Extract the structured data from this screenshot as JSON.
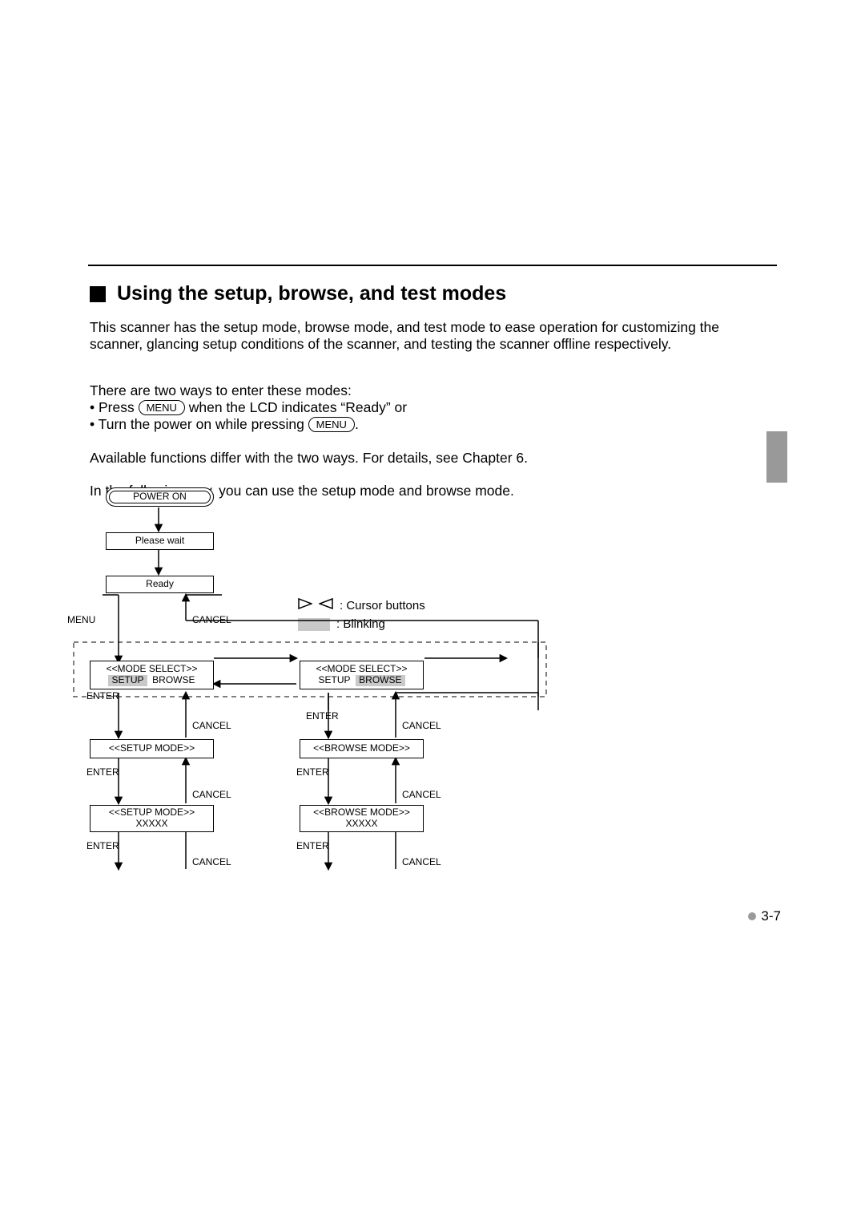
{
  "heading": "Using the setup, browse, and test modes",
  "para1": "This scanner has the setup mode, browse mode, and test mode to ease operation for customizing the scanner, glancing setup conditions of the scanner, and testing the scanner offline respectively.",
  "para2": "There are two ways to enter these modes:",
  "bullet1_pre": "• Press ",
  "bullet1_post": " when the LCD indicates “Ready” or",
  "bullet2_pre": "• Turn the power on while pressing ",
  "bullet2_post": ".",
  "menu_label": "MENU",
  "para3": "Available functions differ with the two ways.  For details, see Chapter 6.",
  "para4": "In the following way, you can use the setup mode and browse mode.",
  "page_number": "3-7",
  "legend": {
    "cursor": ": Cursor buttons",
    "blinking": ": Blinking"
  },
  "diagram": {
    "power_on": "POWER ON",
    "please_wait": "Please wait",
    "ready": "Ready",
    "menu": "MENU",
    "cancel": "CANCEL",
    "enter": "ENTER",
    "mode_select": "<<MODE SELECT>>",
    "setup": "SETUP",
    "browse": "BROWSE",
    "setup_mode": "<<SETUP MODE>>",
    "browse_mode": "<<BROWSE MODE>>",
    "xxxxx": "XXXXX"
  }
}
